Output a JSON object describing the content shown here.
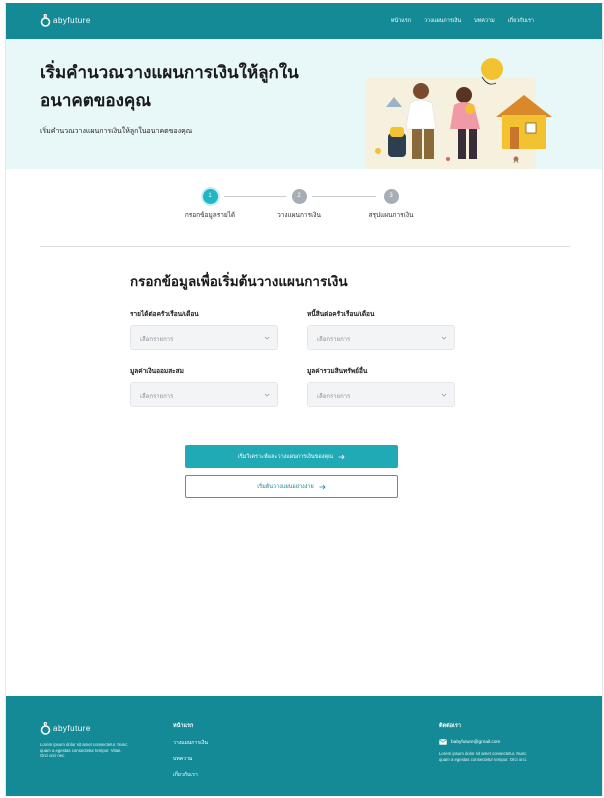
{
  "header": {
    "logo_text": "abyfuture",
    "nav": [
      "หน้าแรก",
      "วางแผนการเงิน",
      "บทความ",
      "เกี่ยวกับเรา"
    ]
  },
  "hero": {
    "title": "เริ่มคำนวณวางแผนการเงินให้ลูกในอนาคตของคุณ",
    "subtitle": "เริ่มคำนวณวางแผนการเงินให้ลูกในอนาคตของคุณ"
  },
  "stepper": {
    "steps": [
      {
        "number": "1",
        "label": "กรอกข้อมูลรายได้"
      },
      {
        "number": "2",
        "label": "วางแผนการเงิน"
      },
      {
        "number": "3",
        "label": "สรุปแผนการเงิน"
      }
    ]
  },
  "form": {
    "title": "กรอกข้อมูลเพื่อเริ่มต้นวางแผนการเงิน",
    "fields": [
      {
        "label": "รายได้ต่อครัวเรือน/เดือน",
        "placeholder": "เลือกรายการ"
      },
      {
        "label": "หนี้สินต่อครัวเรือน/เดือน",
        "placeholder": "เลือกรายการ"
      },
      {
        "label": "มูลค่าเงินออมสะสม",
        "placeholder": "เลือกรายการ"
      },
      {
        "label": "มูลค่ารวมสินทรัพย์อื่น",
        "placeholder": "เลือกรายการ"
      }
    ],
    "primary_button": "เริ่มวิเคราะห์และวางแผนการเงินของคุณ",
    "secondary_button": "เริ่มต้นวางแผนอย่างง่าย"
  },
  "footer": {
    "logo_text": "abyfuture",
    "description": "Lorem ipsum dolor sit amet consectetur. Nunc quam a egestas consectetur tempor. Vitae. Orci orci nec.",
    "links_title": "หน้าแรก",
    "links": [
      "วางแผนการเงิน",
      "บทความ",
      "เกี่ยวกับเรา"
    ],
    "contact_title": "ติดต่อเรา",
    "email": "babyfuture@gmail.com",
    "address": "Lorem ipsum dolor sit amet consectetur. Nunc quam a egestas consectetur tempor. Orci orci."
  },
  "colors": {
    "brand": "#138a95",
    "accent": "#20b6c2",
    "hero_bg": "#e8f8f9"
  },
  "icons": {
    "select": "chevron-down-icon",
    "button": "arrow-right-icon",
    "email": "mail-icon"
  }
}
